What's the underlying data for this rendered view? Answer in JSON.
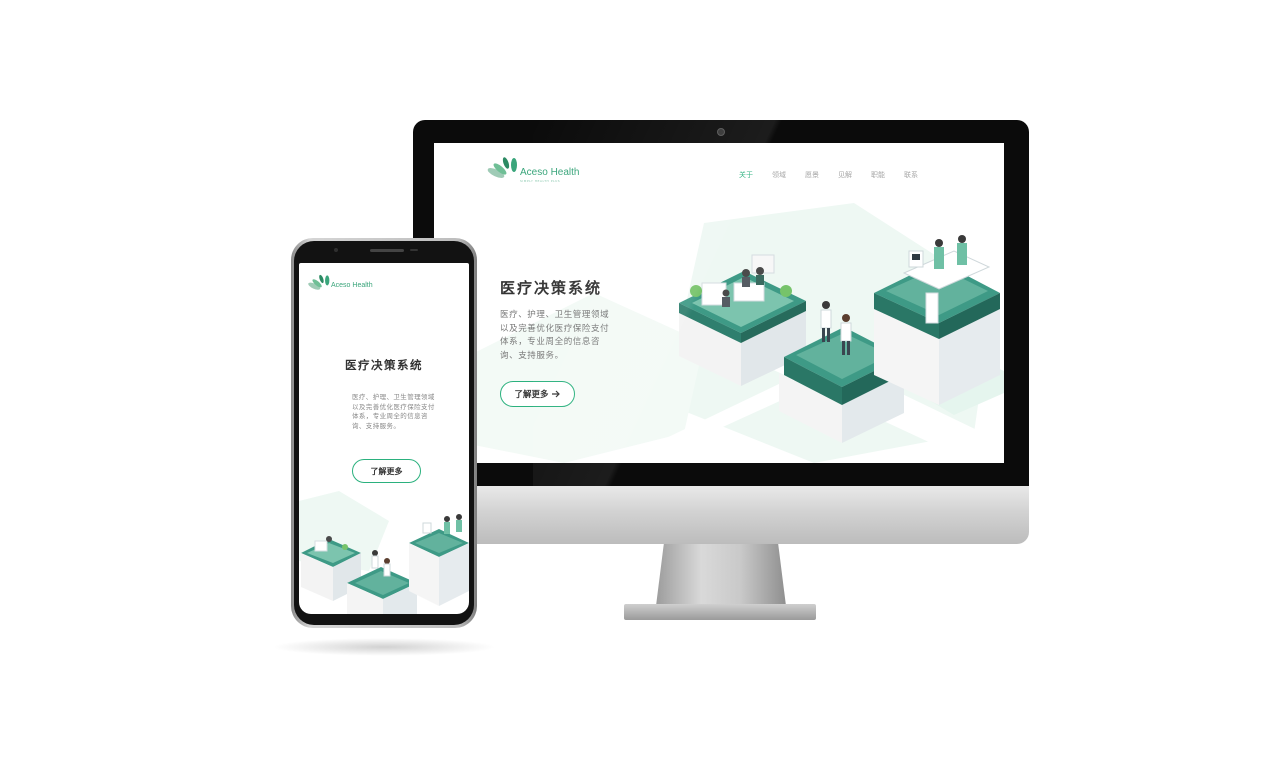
{
  "brand": {
    "name": "Aceso Health",
    "tagline": "SIMPLY HEALTH PLUS",
    "accent": "#2bb17e",
    "logo_green": "#3aa57b"
  },
  "desktop": {
    "nav": [
      "关于",
      "领域",
      "愿景",
      "见解",
      "职能",
      "联系"
    ],
    "hero": {
      "title": "医疗决策系统",
      "description": "医疗、护理、卫生管理领域以及完善优化医疗保险支付体系，专业周全的信息咨询、支持服务。",
      "button_label": "了解更多",
      "button_icon": "arrow-right-icon"
    }
  },
  "mobile": {
    "hero": {
      "title": "医疗决策系统",
      "description": "医疗、护理、卫生管理领域以及完善优化医疗保险支付体系，专业周全的信息咨询、支持服务。",
      "button_label": "了解更多"
    }
  }
}
